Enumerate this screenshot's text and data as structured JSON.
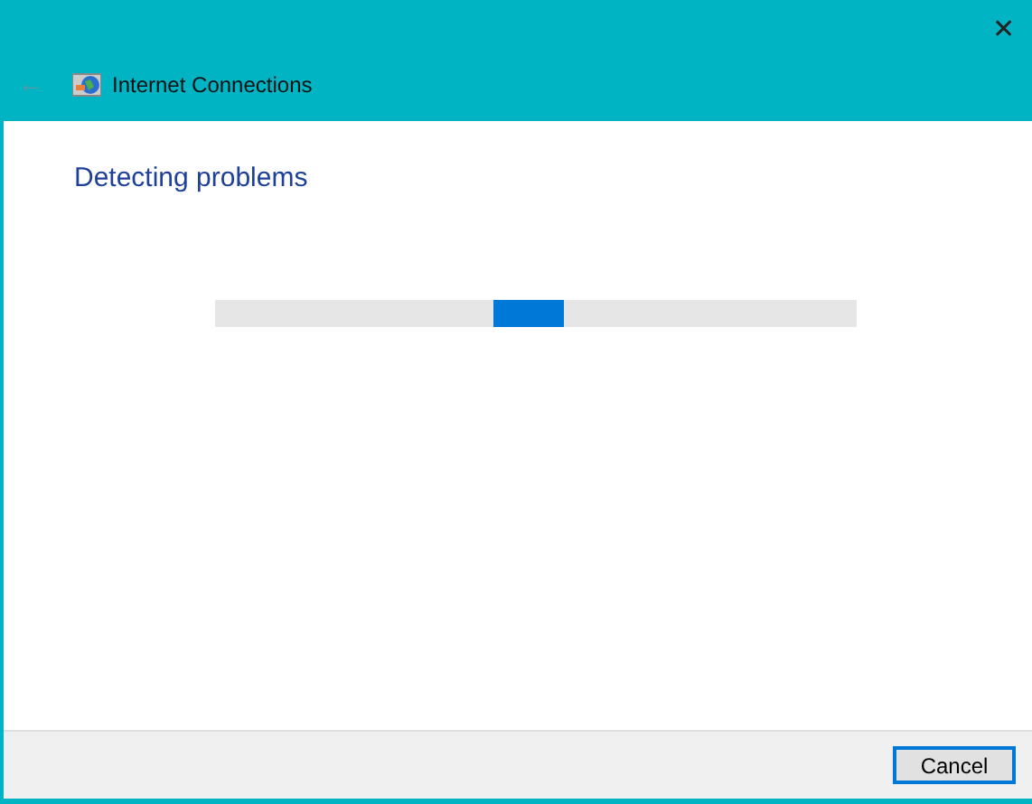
{
  "window": {
    "title": "Internet Connections",
    "close": "✕",
    "back": "←"
  },
  "heading": "Detecting problems",
  "progress": {
    "kind": "marquee"
  },
  "buttons": [
    {
      "label": "Cancel",
      "default": true
    }
  ]
}
